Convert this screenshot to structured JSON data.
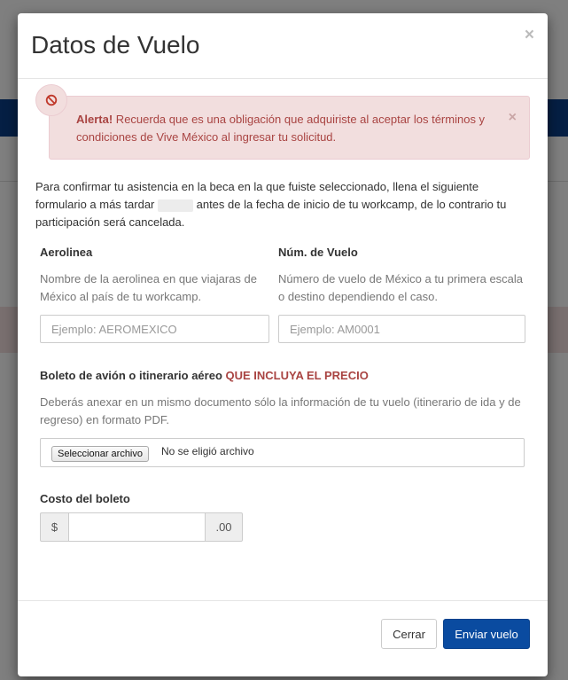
{
  "modal": {
    "title": "Datos de Vuelo",
    "close_symbol": "×"
  },
  "alert": {
    "strong": "Alerta!",
    "message": " Recuerda que es una obligación que adquiriste al aceptar los términos y condiciones de Vive México al ingresar tu solicitud.",
    "close_symbol": "×",
    "icon": "ban-icon",
    "color": "#a94442",
    "background": "#f2dede"
  },
  "intro": {
    "part1": "Para confirmar tu asistencia en la beca en la que fuiste seleccionado, llena el siguiente formulario a más tardar ",
    "part2": " antes de la fecha de inicio de tu workcamp, de lo contrario tu participación será cancelada."
  },
  "airline": {
    "label": "Aerolinea",
    "help": "Nombre de la aerolinea en que viajaras de México al país de tu workcamp.",
    "placeholder": "Ejemplo: AEROMEXICO",
    "value": ""
  },
  "flight": {
    "label": "Núm. de Vuelo",
    "help": "Número de vuelo de México a tu primera escala o destino dependiendo el caso.",
    "placeholder": "Ejemplo: AM0001",
    "value": ""
  },
  "ticket": {
    "label": "Boleto de avión o itinerario aéreo ",
    "label_emphasis": "QUE INCLUYA EL PRECIO",
    "help": "Deberás anexar en un mismo documento sólo la información de tu vuelo (itinerario de ida y de regreso) en formato PDF.",
    "file_button": "Seleccionar archivo",
    "file_status": "No se eligió archivo"
  },
  "cost": {
    "label": "Costo del boleto",
    "prefix": "$",
    "suffix": ".00",
    "value": ""
  },
  "footer": {
    "close_label": "Cerrar",
    "submit_label": "Enviar vuelo"
  },
  "colors": {
    "primary": "#0a4ba0",
    "danger": "#a94442",
    "header_bar": "#0a3f88"
  }
}
